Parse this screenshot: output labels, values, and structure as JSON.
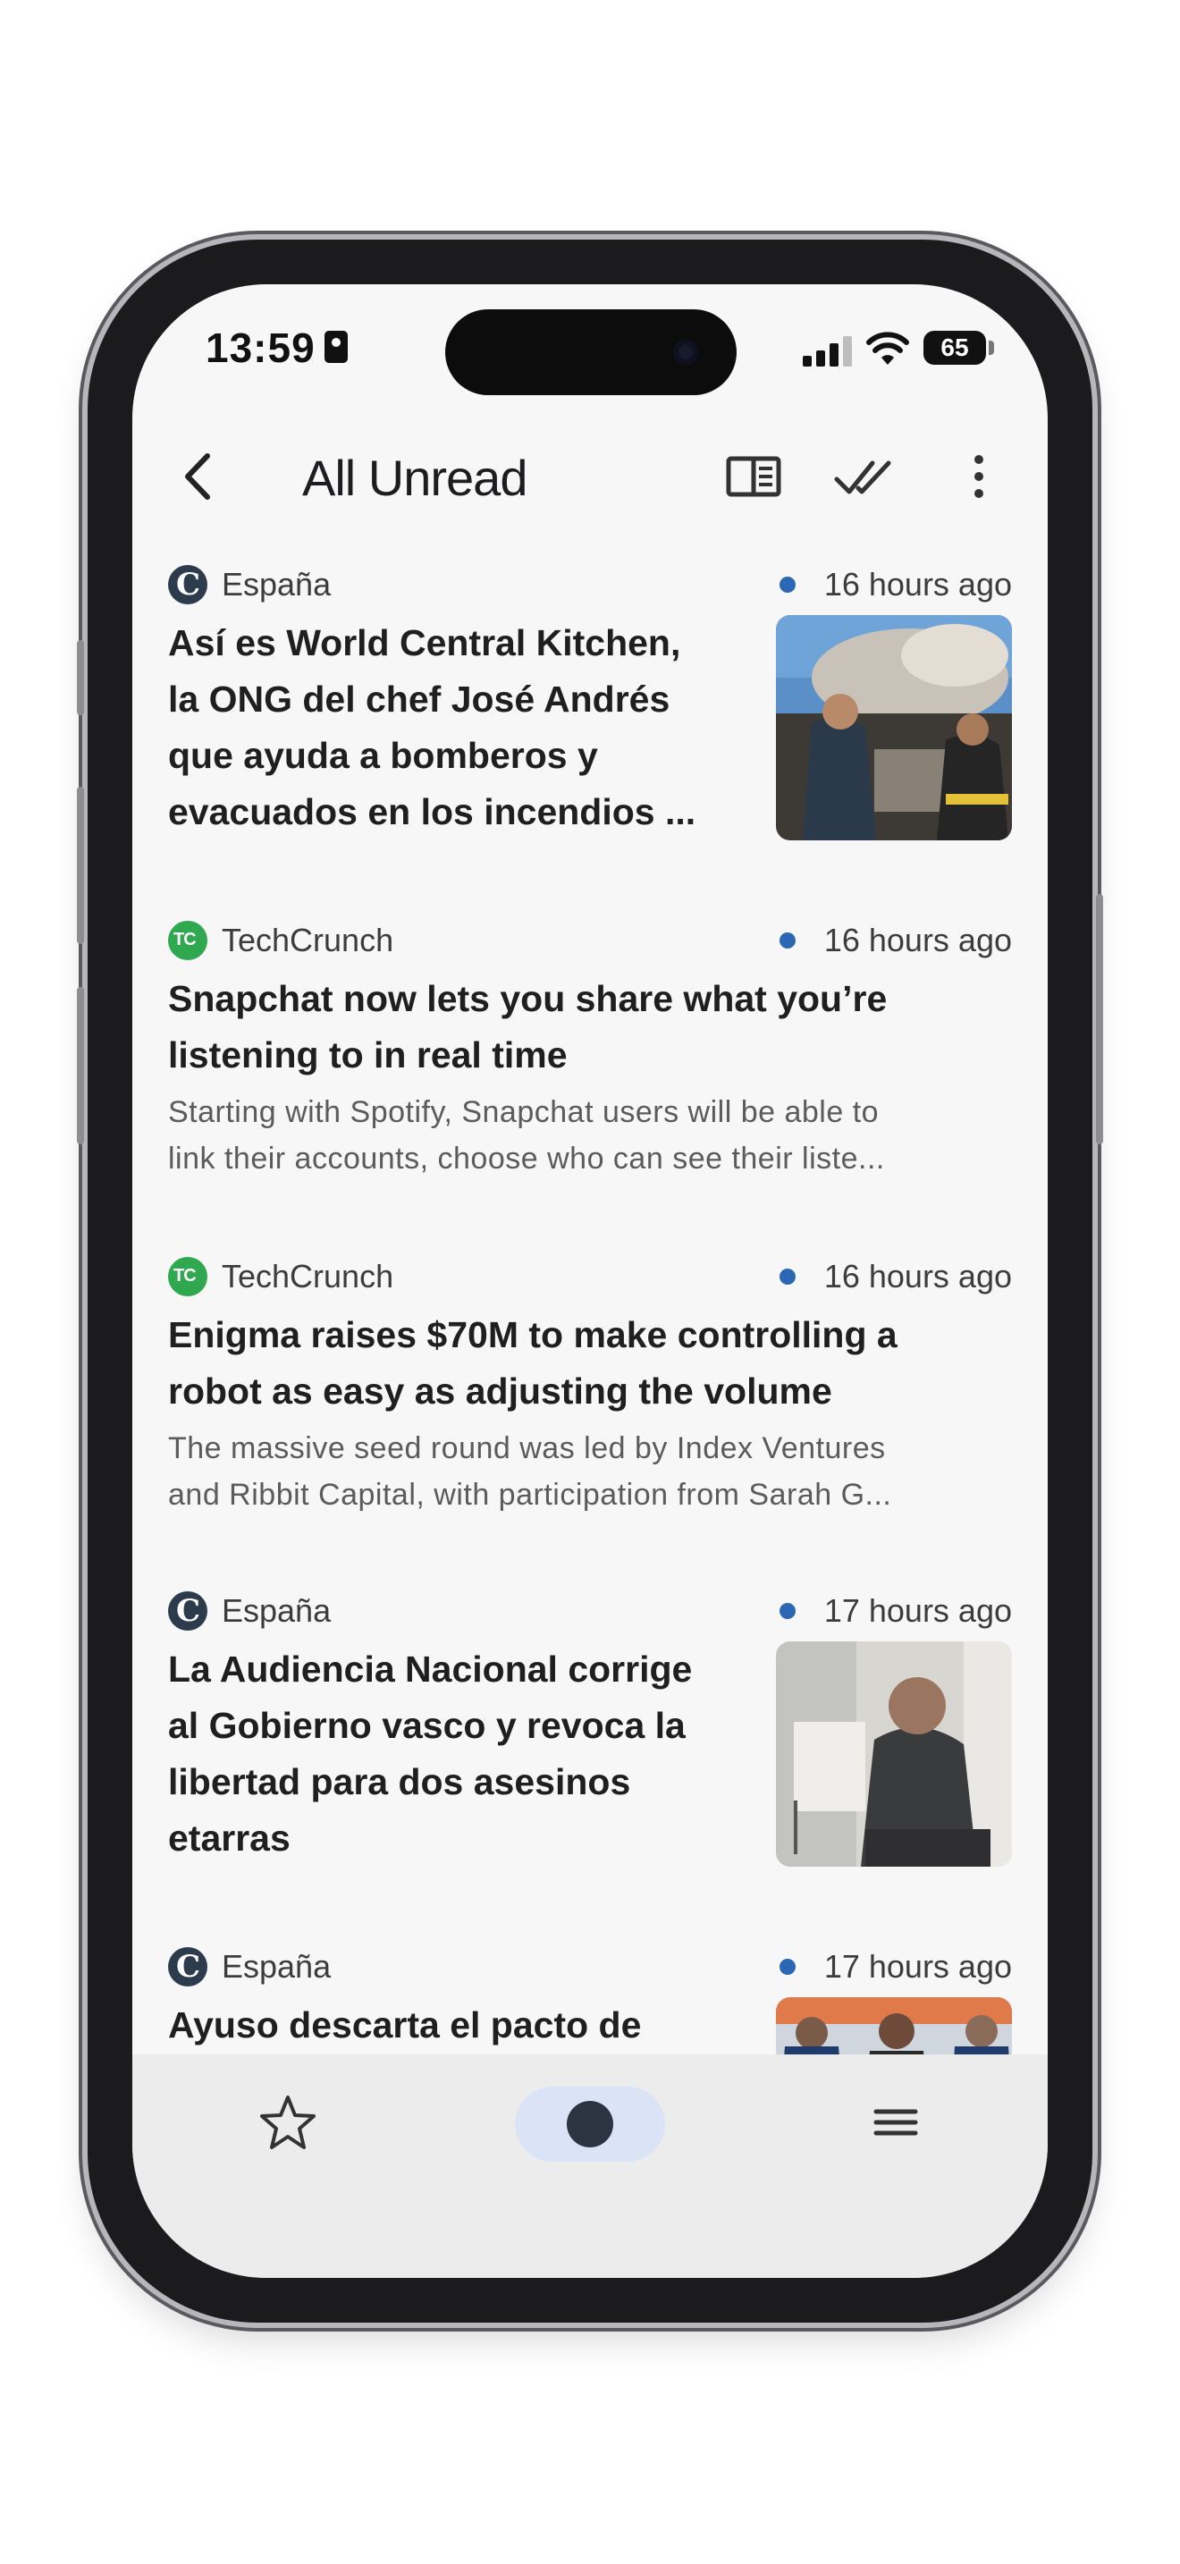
{
  "status_bar": {
    "time": "13:59",
    "battery": "65"
  },
  "app_bar": {
    "title": "All Unread"
  },
  "articles": [
    {
      "source": "España",
      "time": "16 hours ago",
      "headline_lines": [
        "Así es World Central Kitchen,",
        "la ONG del chef José Andrés",
        "que ayuda a bomberos y",
        "evacuados en los incendios ..."
      ]
    },
    {
      "source": "TechCrunch",
      "time": "16 hours ago",
      "headline_lines": [
        "Snapchat now lets you share what you’re",
        "listening to in real time"
      ],
      "summary_lines": [
        "Starting with Spotify, Snapchat users will be able to",
        "link their accounts, choose who can see their liste..."
      ]
    },
    {
      "source": "TechCrunch",
      "time": "16 hours ago",
      "headline_lines": [
        "Enigma raises $70M to make controlling a",
        "robot as easy as adjusting the volume"
      ],
      "summary_lines": [
        "The massive seed round was led by  Index Ventures",
        "and Ribbit Capital, with participation from Sarah G..."
      ]
    },
    {
      "source": "España",
      "time": "17 hours ago",
      "headline_lines": [
        "La Audiencia Nacional corrige",
        "al Gobierno vasco y revoca la",
        "libertad para dos asesinos",
        "etarras"
      ]
    },
    {
      "source": "España",
      "time": "17 hours ago",
      "headline_lines": [
        "Ayuso descarta el pacto de"
      ]
    }
  ],
  "colors": {
    "unread_dot": "#2b67b3",
    "nav_pill": "#dbe4f6"
  }
}
